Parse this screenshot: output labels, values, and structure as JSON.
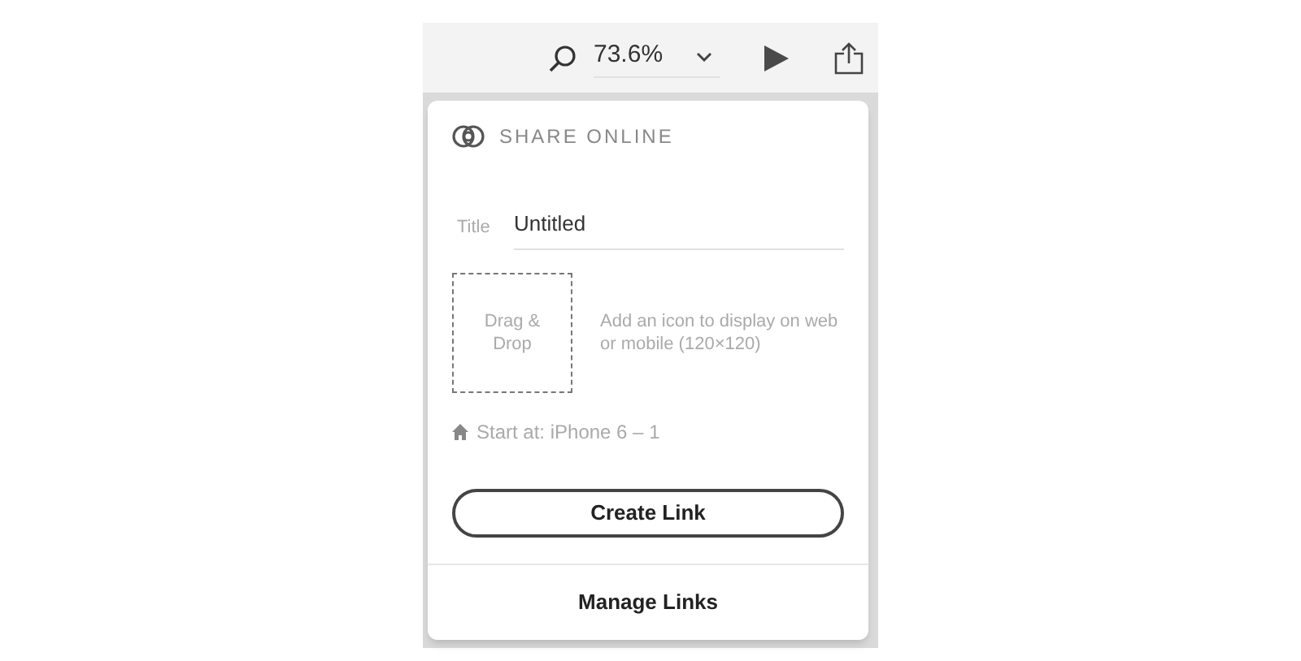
{
  "toolbar": {
    "zoom": "73.6%"
  },
  "share_panel": {
    "title": "SHARE ONLINE",
    "title_field": {
      "label": "Title",
      "value": "Untitled"
    },
    "drop_zone": {
      "text": "Drag & Drop",
      "hint": "Add an icon to display on web or mobile (120×120)"
    },
    "start_at": "Start at: iPhone 6 – 1",
    "create_button": "Create Link",
    "manage_button": "Manage Links"
  }
}
